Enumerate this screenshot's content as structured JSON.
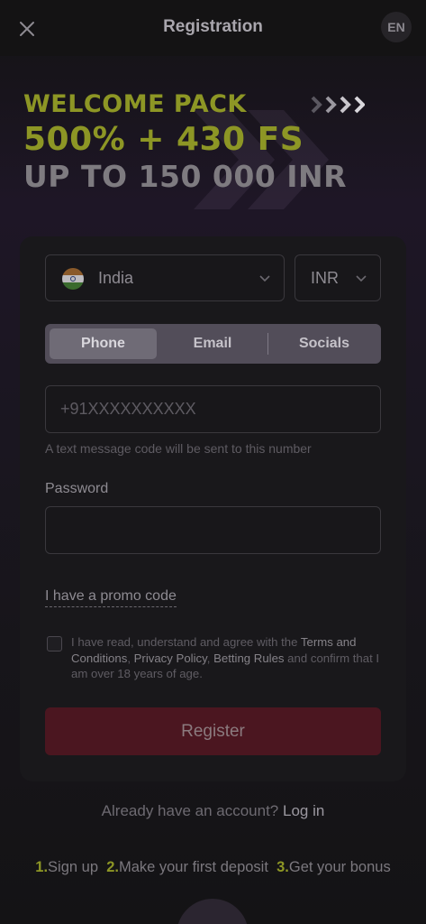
{
  "header": {
    "title": "Registration",
    "lang": "EN"
  },
  "banner": {
    "line1": "WELCOME PACK",
    "line2": "500% + 430 FS",
    "line3": "UP TO 150 000 INR",
    "accent_color": "#8d9625"
  },
  "form": {
    "country": "India",
    "currency": "INR",
    "tabs": [
      {
        "label": "Phone",
        "active": true
      },
      {
        "label": "Email",
        "active": false
      },
      {
        "label": "Socials",
        "active": false
      }
    ],
    "phone_placeholder": "+91XXXXXXXXXX",
    "phone_hint": "A text message code will be sent to this number",
    "password_label": "Password",
    "password_value": "",
    "promo_link": "I have a promo code",
    "terms": {
      "t1": "I have read, understand and agree with the ",
      "link1": "Terms and Conditions",
      "sep1": ", ",
      "link2": "Privacy Policy",
      "sep2": ", ",
      "link3": "Betting Rules",
      "t2": " and confirm that I am over 18 years of age."
    },
    "checkbox_checked": false,
    "register_label": "Register",
    "register_color": "#4b1620"
  },
  "footer": {
    "login_prompt": "Already have an account? ",
    "login_link": "Log in",
    "steps": [
      {
        "num": "1.",
        "label": "Sign up"
      },
      {
        "num": "2.",
        "label": "Make your first deposit"
      },
      {
        "num": "3.",
        "label": "Get your bonus"
      }
    ]
  },
  "icons": {
    "close": "close-icon",
    "flag": "india-flag-icon",
    "chevron": "chevron-down-icon",
    "arrows": "triple-chevron-right-icon"
  }
}
